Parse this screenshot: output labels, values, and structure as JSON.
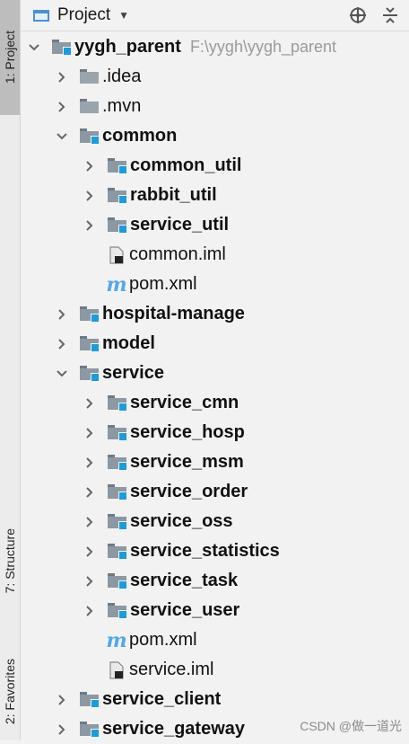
{
  "side_tabs": {
    "project": "1: Project",
    "structure": "7: Structure",
    "favorites": "2: Favorites"
  },
  "header": {
    "title": "Project",
    "caret_icon": "caret-down-icon",
    "locate_icon": "crosshair-icon",
    "collapse_icon": "collapse-all-icon"
  },
  "tree": [
    {
      "label": "yygh_parent",
      "path": "F:\\yygh\\yygh_parent",
      "depth": 0,
      "arrow": "down",
      "icon": "module",
      "bold": true
    },
    {
      "label": ".idea",
      "depth": 1,
      "arrow": "right",
      "icon": "folder",
      "bold": false
    },
    {
      "label": ".mvn",
      "depth": 1,
      "arrow": "right",
      "icon": "folder",
      "bold": false
    },
    {
      "label": "common",
      "depth": 1,
      "arrow": "down",
      "icon": "module",
      "bold": true
    },
    {
      "label": "common_util",
      "depth": 2,
      "arrow": "right",
      "icon": "module",
      "bold": true
    },
    {
      "label": "rabbit_util",
      "depth": 2,
      "arrow": "right",
      "icon": "module",
      "bold": true
    },
    {
      "label": "service_util",
      "depth": 2,
      "arrow": "right",
      "icon": "module",
      "bold": true
    },
    {
      "label": "common.iml",
      "depth": 2,
      "arrow": "none",
      "icon": "iml",
      "bold": false
    },
    {
      "label": "pom.xml",
      "depth": 2,
      "arrow": "none",
      "icon": "maven",
      "bold": false
    },
    {
      "label": "hospital-manage",
      "depth": 1,
      "arrow": "right",
      "icon": "module",
      "bold": true
    },
    {
      "label": "model",
      "depth": 1,
      "arrow": "right",
      "icon": "module",
      "bold": true
    },
    {
      "label": "service",
      "depth": 1,
      "arrow": "down",
      "icon": "module",
      "bold": true
    },
    {
      "label": "service_cmn",
      "depth": 2,
      "arrow": "right",
      "icon": "module",
      "bold": true
    },
    {
      "label": "service_hosp",
      "depth": 2,
      "arrow": "right",
      "icon": "module",
      "bold": true
    },
    {
      "label": "service_msm",
      "depth": 2,
      "arrow": "right",
      "icon": "module",
      "bold": true
    },
    {
      "label": "service_order",
      "depth": 2,
      "arrow": "right",
      "icon": "module",
      "bold": true
    },
    {
      "label": "service_oss",
      "depth": 2,
      "arrow": "right",
      "icon": "module",
      "bold": true
    },
    {
      "label": "service_statistics",
      "depth": 2,
      "arrow": "right",
      "icon": "module",
      "bold": true
    },
    {
      "label": "service_task",
      "depth": 2,
      "arrow": "right",
      "icon": "module",
      "bold": true
    },
    {
      "label": "service_user",
      "depth": 2,
      "arrow": "right",
      "icon": "module",
      "bold": true
    },
    {
      "label": "pom.xml",
      "depth": 2,
      "arrow": "none",
      "icon": "maven",
      "bold": false
    },
    {
      "label": "service.iml",
      "depth": 2,
      "arrow": "none",
      "icon": "iml",
      "bold": false
    },
    {
      "label": "service_client",
      "depth": 1,
      "arrow": "right",
      "icon": "module",
      "bold": true
    },
    {
      "label": "service_gateway",
      "depth": 1,
      "arrow": "right",
      "icon": "module",
      "bold": true
    }
  ],
  "watermark": "CSDN @做一道光",
  "colors": {
    "module_marker": "#1f9bd7",
    "folder": "#8c98a3",
    "maven": "#55a8e6",
    "path_text": "#9a9a9a"
  }
}
